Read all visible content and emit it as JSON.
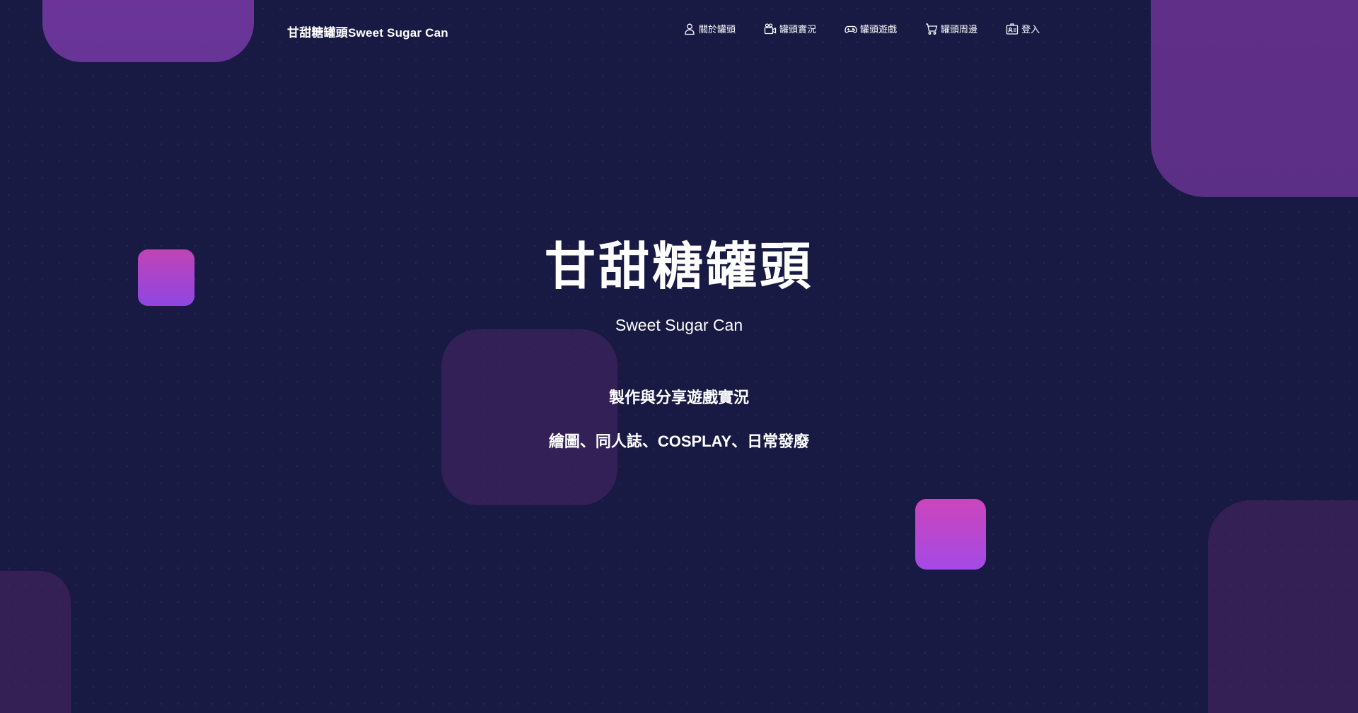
{
  "brand": {
    "title": "甘甜糖罐頭Sweet Sugar Can"
  },
  "nav": {
    "items": [
      {
        "label": "關於罐頭",
        "icon": "user-icon"
      },
      {
        "label": "罐頭實況",
        "icon": "video-camera-icon"
      },
      {
        "label": "罐頭遊戲",
        "icon": "gamepad-icon"
      },
      {
        "label": "罐頭周邊",
        "icon": "cart-icon"
      },
      {
        "label": "登入",
        "icon": "login-badge-icon"
      }
    ]
  },
  "hero": {
    "title": "甘甜糖罐頭",
    "subtitle": "Sweet Sugar Can",
    "line1": "製作與分享遊戲實況",
    "line2": "繪圖、同人誌、COSPLAY、日常發廢"
  },
  "colors": {
    "background": "#181a43",
    "accent_pink": "#cc45bb",
    "accent_purple": "#8e46e3",
    "shape_purple": "#673597"
  }
}
